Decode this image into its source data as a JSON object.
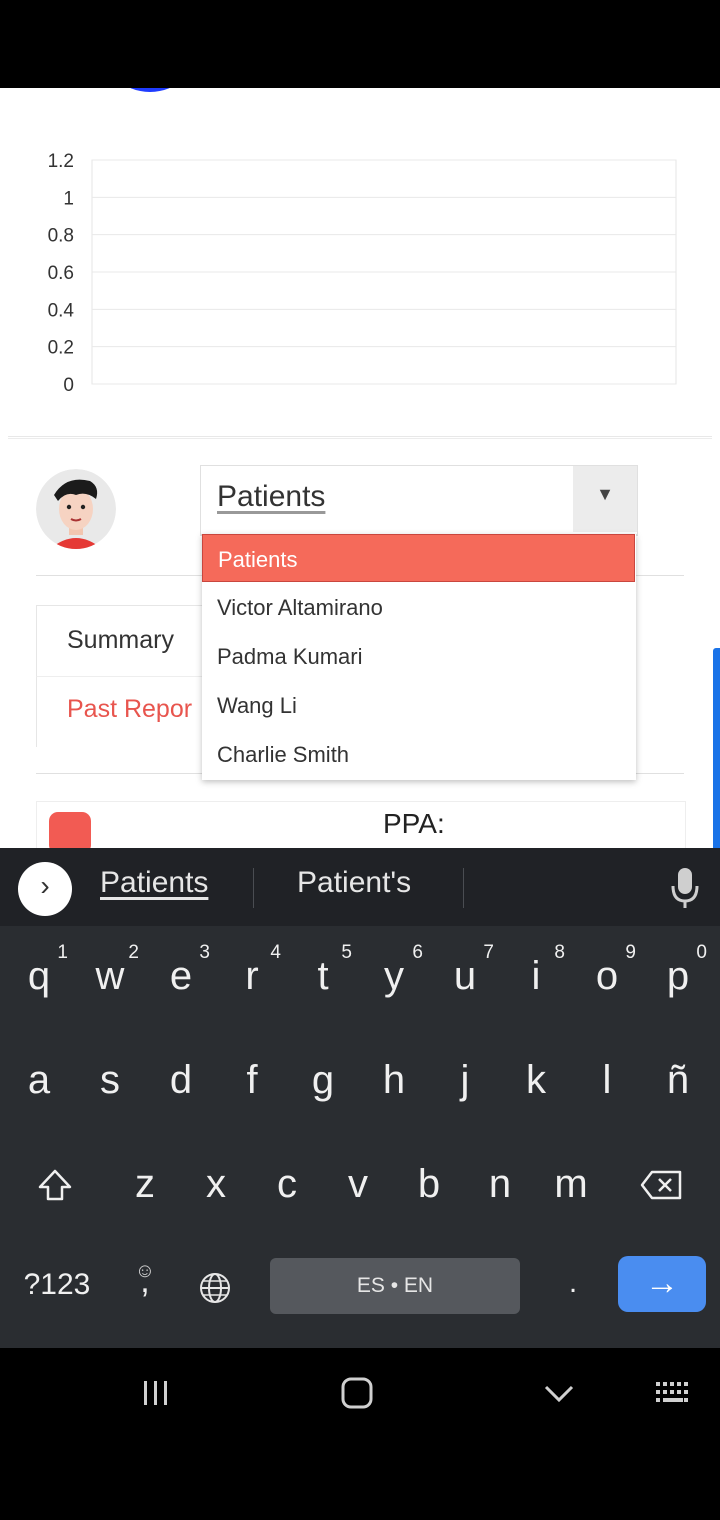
{
  "chart": {
    "y_ticks": [
      "1.2",
      "1",
      "0.8",
      "0.6",
      "0.4",
      "0.2",
      "0"
    ]
  },
  "chart_data": {
    "type": "line",
    "series": [],
    "ylim": [
      0,
      1.2
    ],
    "y_ticks": [
      0,
      0.2,
      0.4,
      0.6,
      0.8,
      1,
      1.2
    ],
    "grid": true
  },
  "patient_select": {
    "value": "Patients",
    "options": [
      "Patients",
      "Victor Altamirano",
      "Padma Kumari",
      "Wang Li",
      "Charlie Smith"
    ]
  },
  "tabs": {
    "summary": "Summary",
    "past_reports": "Past Repor"
  },
  "ppa": {
    "label": "PPA:"
  },
  "keyboard": {
    "suggestions": [
      "Patients",
      "Patient's"
    ],
    "row1": [
      {
        "k": "q",
        "h": "1"
      },
      {
        "k": "w",
        "h": "2"
      },
      {
        "k": "e",
        "h": "3"
      },
      {
        "k": "r",
        "h": "4"
      },
      {
        "k": "t",
        "h": "5"
      },
      {
        "k": "y",
        "h": "6"
      },
      {
        "k": "u",
        "h": "7"
      },
      {
        "k": "i",
        "h": "8"
      },
      {
        "k": "o",
        "h": "9"
      },
      {
        "k": "p",
        "h": "0"
      }
    ],
    "row2": [
      "a",
      "s",
      "d",
      "f",
      "g",
      "h",
      "j",
      "k",
      "l",
      "ñ"
    ],
    "row3": [
      "z",
      "x",
      "c",
      "v",
      "b",
      "n",
      "m"
    ],
    "symbols_key": "?123",
    "comma_key": ",",
    "period_key": ".",
    "space_label": "ES • EN"
  },
  "colors": {
    "accent": "#f56a5a",
    "enter_key": "#4a8df0",
    "keyboard_bg": "#2a2d31"
  }
}
